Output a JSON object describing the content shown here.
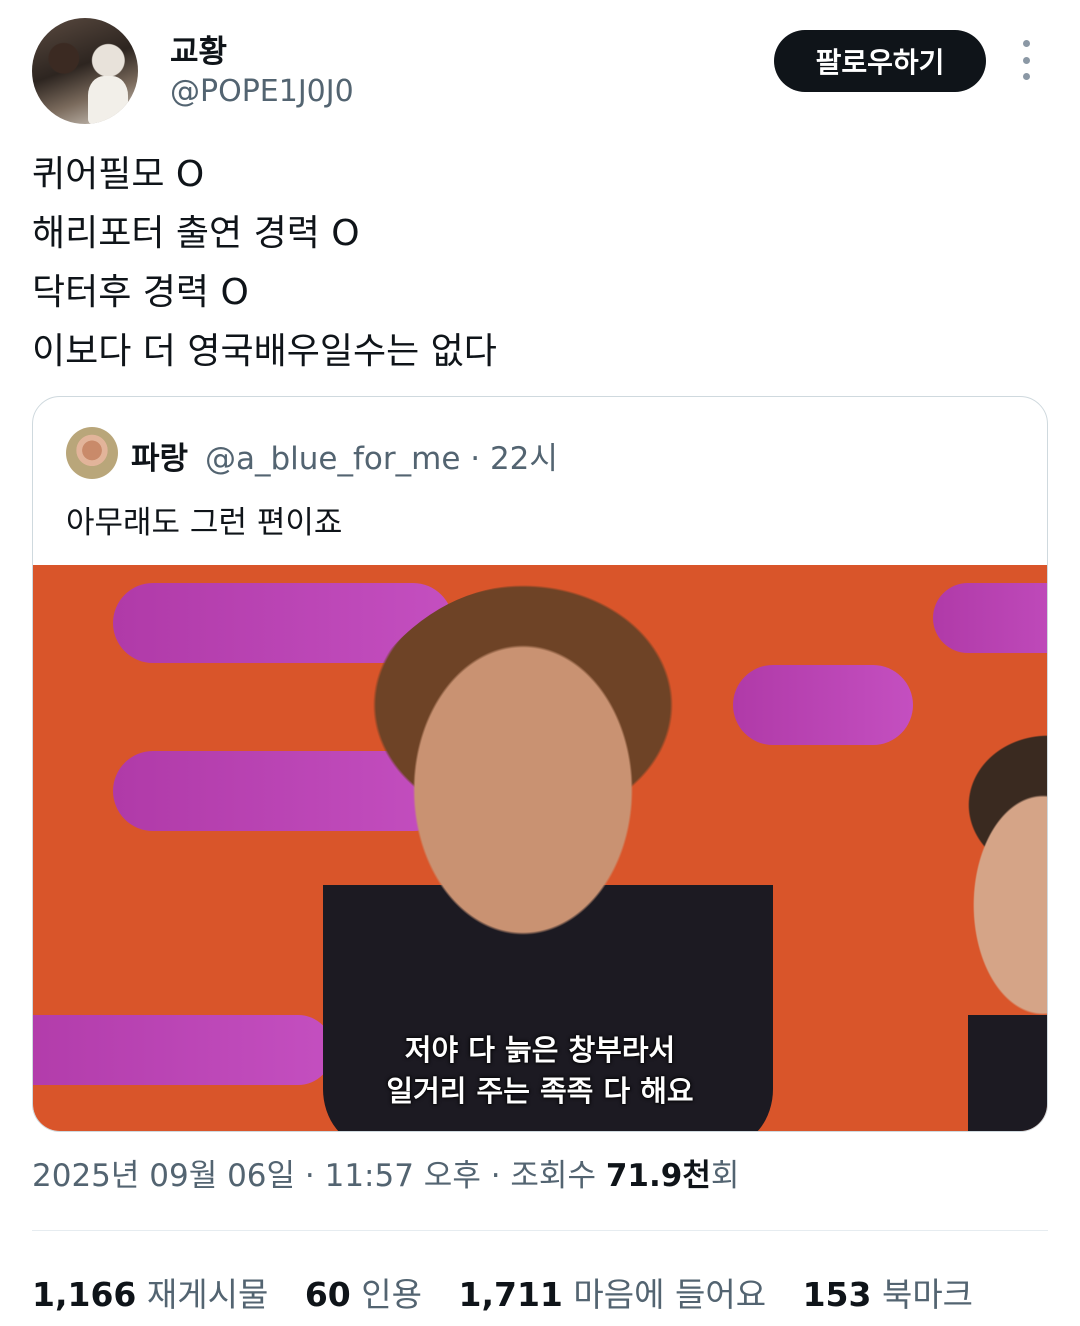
{
  "author": {
    "name": "교황",
    "handle": "@POPE1J0J0"
  },
  "follow_label": "팔로우하기",
  "tweet": {
    "lines": [
      "퀴어필모 O",
      "해리포터 출연 경력 O",
      "닥터후 경력 O",
      "이보다 더 영국배우일수는 없다"
    ]
  },
  "quote": {
    "name": "파랑",
    "handle_time": "@a_blue_for_me · 22시",
    "text": "아무래도 그런 편이죠",
    "subtitles": [
      "저야 다 늙은 창부라서",
      "일거리 주는 족족 다 해요"
    ]
  },
  "meta": {
    "date": "2025년 09월 06일 · 11:57 오후 · 조회수 ",
    "views": "71.9천",
    "views_suffix": "회"
  },
  "stats": {
    "retweets": "1,166",
    "retweets_label": "재게시물",
    "quotes": "60",
    "quotes_label": "인용",
    "likes": "1,711",
    "likes_label": "마음에 들어요",
    "bookmarks": "153",
    "bookmarks_label": "북마크"
  }
}
